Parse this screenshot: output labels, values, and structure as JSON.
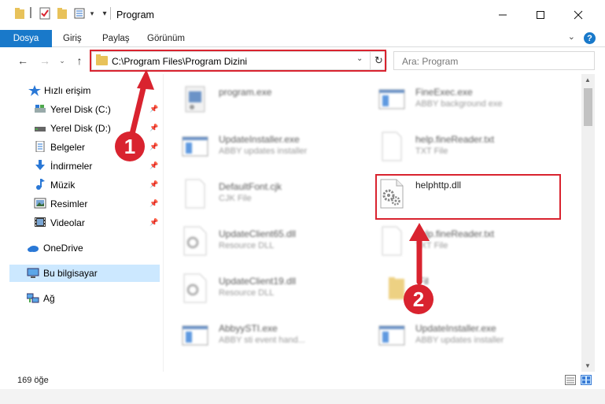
{
  "window": {
    "title": "Program",
    "minimize_icon": "minimize-icon",
    "maximize_icon": "maximize-icon",
    "close_icon": "close-icon"
  },
  "ribbon": {
    "file_tab": "Dosya",
    "tabs": [
      "Giriş",
      "Paylaş",
      "Görünüm"
    ],
    "help": "?"
  },
  "nav": {
    "address": "C:\\Program Files\\Program Dizini",
    "search_placeholder": "Ara: Program"
  },
  "sidebar": {
    "quick_access": "Hızlı erişim",
    "items": [
      {
        "label": "Yerel Disk (C:)",
        "icon": "drive-icon"
      },
      {
        "label": "Yerel Disk (D:)",
        "icon": "drive-icon"
      },
      {
        "label": "Belgeler",
        "icon": "documents-icon"
      },
      {
        "label": "İndirmeler",
        "icon": "downloads-icon"
      },
      {
        "label": "Müzik",
        "icon": "music-icon"
      },
      {
        "label": "Resimler",
        "icon": "pictures-icon"
      },
      {
        "label": "Videolar",
        "icon": "videos-icon"
      }
    ],
    "onedrive": "OneDrive",
    "this_pc": "Bu bilgisayar",
    "network": "Ağ"
  },
  "files": [
    {
      "name": "program.exe",
      "desc": ""
    },
    {
      "name": "FineExec.exe",
      "desc": "ABBY background exe"
    },
    {
      "name": "UpdateInstaller.exe",
      "desc": "ABBY updates installer"
    },
    {
      "name": "help.fineReader.txt",
      "desc": "TXT File"
    },
    {
      "name": "DefaultFont.cjk",
      "desc": "CJK File"
    },
    {
      "name": "helphttp.dll",
      "desc": ""
    },
    {
      "name": "UpdateClient65.dll",
      "desc": "Resource DLL"
    },
    {
      "name": "help.fineReader.txt",
      "desc": "TXT File"
    },
    {
      "name": "UpdateClient19.dll",
      "desc": "Resource DLL"
    },
    {
      "name": "Fil",
      "desc": ""
    },
    {
      "name": "AbbyySTI.exe",
      "desc": "ABBY sti event hand..."
    },
    {
      "name": "UpdateInstaller.exe",
      "desc": "ABBY updates installer"
    }
  ],
  "status": {
    "count": "169 öğe"
  },
  "annotations": {
    "step1": "1",
    "step2": "2",
    "accent": "#d9232f"
  }
}
